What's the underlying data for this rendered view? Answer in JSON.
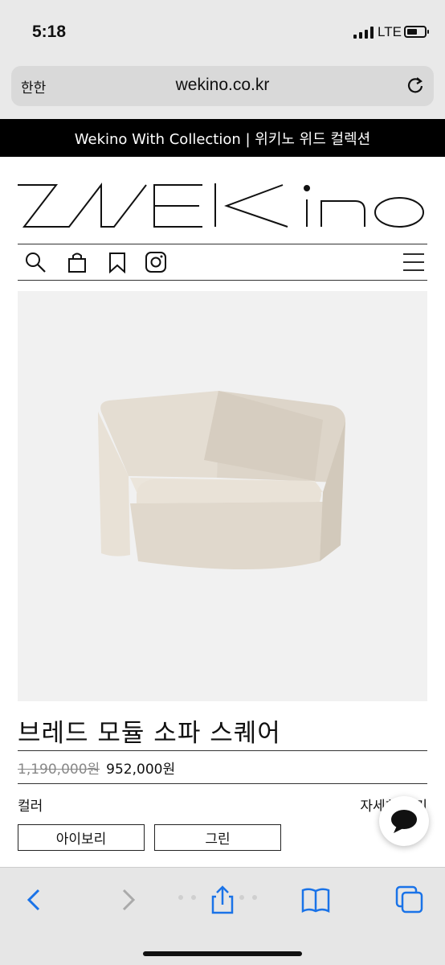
{
  "status_bar": {
    "time": "5:18",
    "network": "LTE"
  },
  "browser": {
    "aa_label": "한한",
    "url": "wekino.co.kr"
  },
  "site": {
    "banner": "Wekino With Collection | 위키노 위드 컬렉션",
    "logo": "WEKiNO"
  },
  "nav_icons": [
    "search-icon",
    "shopping-bag-icon",
    "bookmark-icon",
    "instagram-icon",
    "menu-icon"
  ],
  "product": {
    "title": "브레드 모듈 소파 스퀘어",
    "original_price": "1,190,000원",
    "sale_price": "952,000원",
    "color_label": "컬러",
    "detail_link": "자세히 보기",
    "options": [
      "아이보리",
      "그린"
    ]
  },
  "colors": {
    "banner_bg": "#000000",
    "sofa": "#e4ddd2"
  }
}
